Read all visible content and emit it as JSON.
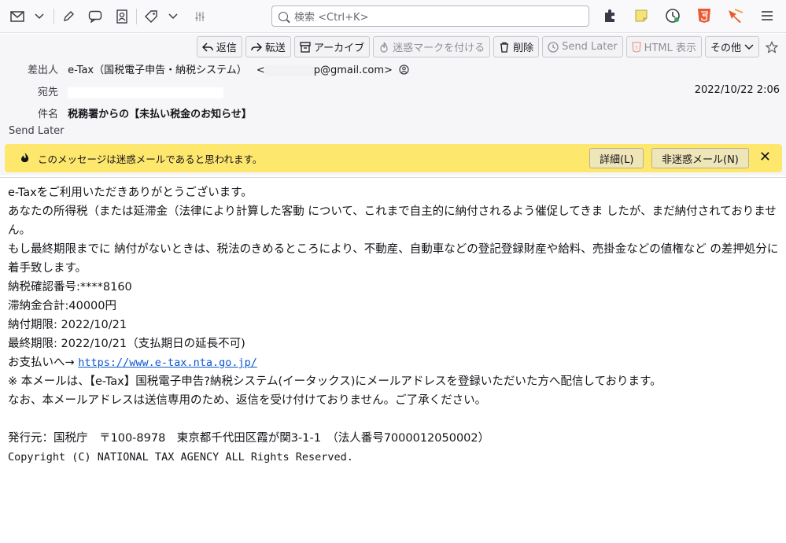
{
  "toolbar": {
    "search_placeholder": "検索 <Ctrl+K>",
    "icons": [
      "mail-icon",
      "chevron-down-icon",
      "pencil-icon",
      "chat-icon",
      "address-book-icon",
      "tag-icon",
      "chevron-down-icon",
      "filter-icon"
    ],
    "right_icons": [
      "puzzle-icon",
      "sticky-note-icon",
      "clock-icon",
      "html5-icon",
      "arrow-icon",
      "hamburger-icon"
    ]
  },
  "actions": {
    "reply": "返信",
    "forward": "転送",
    "archive": "アーカイブ",
    "mark_junk": "迷惑マークを付ける",
    "delete": "削除",
    "send_later": "Send Later",
    "html_view": "HTML 表示",
    "other": "その他"
  },
  "header": {
    "from_label": "差出人",
    "from_name": "e-Tax（国税電子申告・納税システム）",
    "from_email_start": "<",
    "from_email_end": "p@gmail.com>",
    "to_label": "宛先",
    "date": "2022/10/22 2:06",
    "subject_label": "件名",
    "subject": "税務署からの【未払い税金のお知らせ】",
    "send_later_note": "Send Later"
  },
  "junk": {
    "message": "このメッセージは迷惑メールであると思われます。",
    "details_button": "詳細(L)",
    "not_junk_button": "非迷惑メール(N)",
    "close": "✕"
  },
  "body": {
    "l1": "e-Taxをご利用いただきありがとうございます。",
    "l2": "あなたの所得税（または延滞金（法律により計算した客動 について、これまで自主的に納付されるよう催促してきま したが、まだ納付されておりません。",
    "l3": "もし最終期限までに 納付がないときは、税法のきめるところにより、不動産、自動車などの登記登録財産や給料、売掛金などの値権など の差押処分に着手致します。",
    "l4": "納税確認番号:****8160",
    "l5": "滞納金合計:40000円",
    "l6": "納付期限: 2022/10/21",
    "l7": "最終期限: 2022/10/21（支払期日の延長不可)",
    "l8_prefix": "お支払いへ→ ",
    "l8_link": "https://www.e-tax.nta.go.jp/",
    "l9": "※ 本メールは、【e-Tax】国税電子申告?納税システム(イータックス)にメールアドレスを登録いただいた方へ配信しております。",
    "l10": "なお、本メールアドレスは送信専用のため、返信を受け付けておりません。ご了承ください。",
    "l11": "発行元：国税庁　〒100-8978　東京都千代田区霞が関3-1-1　（法人番号7000012050002）",
    "l12": "Copyright (C) NATIONAL TAX AGENCY ALL Rights Reserved."
  }
}
